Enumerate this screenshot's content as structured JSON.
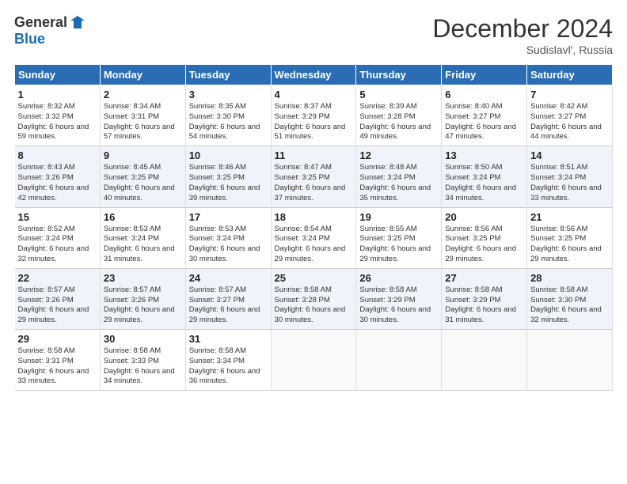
{
  "header": {
    "logo_line1": "General",
    "logo_line2": "Blue",
    "month": "December 2024",
    "location": "Sudislavl', Russia"
  },
  "weekdays": [
    "Sunday",
    "Monday",
    "Tuesday",
    "Wednesday",
    "Thursday",
    "Friday",
    "Saturday"
  ],
  "weeks": [
    [
      {
        "day": "1",
        "sunrise": "8:32 AM",
        "sunset": "3:32 PM",
        "daylight": "6 hours and 59 minutes."
      },
      {
        "day": "2",
        "sunrise": "8:34 AM",
        "sunset": "3:31 PM",
        "daylight": "6 hours and 57 minutes."
      },
      {
        "day": "3",
        "sunrise": "8:35 AM",
        "sunset": "3:30 PM",
        "daylight": "6 hours and 54 minutes."
      },
      {
        "day": "4",
        "sunrise": "8:37 AM",
        "sunset": "3:29 PM",
        "daylight": "6 hours and 51 minutes."
      },
      {
        "day": "5",
        "sunrise": "8:39 AM",
        "sunset": "3:28 PM",
        "daylight": "6 hours and 49 minutes."
      },
      {
        "day": "6",
        "sunrise": "8:40 AM",
        "sunset": "3:27 PM",
        "daylight": "6 hours and 47 minutes."
      },
      {
        "day": "7",
        "sunrise": "8:42 AM",
        "sunset": "3:27 PM",
        "daylight": "6 hours and 44 minutes."
      }
    ],
    [
      {
        "day": "8",
        "sunrise": "8:43 AM",
        "sunset": "3:26 PM",
        "daylight": "6 hours and 42 minutes."
      },
      {
        "day": "9",
        "sunrise": "8:45 AM",
        "sunset": "3:25 PM",
        "daylight": "6 hours and 40 minutes."
      },
      {
        "day": "10",
        "sunrise": "8:46 AM",
        "sunset": "3:25 PM",
        "daylight": "6 hours and 39 minutes."
      },
      {
        "day": "11",
        "sunrise": "8:47 AM",
        "sunset": "3:25 PM",
        "daylight": "6 hours and 37 minutes."
      },
      {
        "day": "12",
        "sunrise": "8:48 AM",
        "sunset": "3:24 PM",
        "daylight": "6 hours and 35 minutes."
      },
      {
        "day": "13",
        "sunrise": "8:50 AM",
        "sunset": "3:24 PM",
        "daylight": "6 hours and 34 minutes."
      },
      {
        "day": "14",
        "sunrise": "8:51 AM",
        "sunset": "3:24 PM",
        "daylight": "6 hours and 33 minutes."
      }
    ],
    [
      {
        "day": "15",
        "sunrise": "8:52 AM",
        "sunset": "3:24 PM",
        "daylight": "6 hours and 32 minutes."
      },
      {
        "day": "16",
        "sunrise": "8:53 AM",
        "sunset": "3:24 PM",
        "daylight": "6 hours and 31 minutes."
      },
      {
        "day": "17",
        "sunrise": "8:53 AM",
        "sunset": "3:24 PM",
        "daylight": "6 hours and 30 minutes."
      },
      {
        "day": "18",
        "sunrise": "8:54 AM",
        "sunset": "3:24 PM",
        "daylight": "6 hours and 29 minutes."
      },
      {
        "day": "19",
        "sunrise": "8:55 AM",
        "sunset": "3:25 PM",
        "daylight": "6 hours and 29 minutes."
      },
      {
        "day": "20",
        "sunrise": "8:56 AM",
        "sunset": "3:25 PM",
        "daylight": "6 hours and 29 minutes."
      },
      {
        "day": "21",
        "sunrise": "8:56 AM",
        "sunset": "3:25 PM",
        "daylight": "6 hours and 29 minutes."
      }
    ],
    [
      {
        "day": "22",
        "sunrise": "8:57 AM",
        "sunset": "3:26 PM",
        "daylight": "6 hours and 29 minutes."
      },
      {
        "day": "23",
        "sunrise": "8:57 AM",
        "sunset": "3:26 PM",
        "daylight": "6 hours and 29 minutes."
      },
      {
        "day": "24",
        "sunrise": "8:57 AM",
        "sunset": "3:27 PM",
        "daylight": "6 hours and 29 minutes."
      },
      {
        "day": "25",
        "sunrise": "8:58 AM",
        "sunset": "3:28 PM",
        "daylight": "6 hours and 30 minutes."
      },
      {
        "day": "26",
        "sunrise": "8:58 AM",
        "sunset": "3:29 PM",
        "daylight": "6 hours and 30 minutes."
      },
      {
        "day": "27",
        "sunrise": "8:58 AM",
        "sunset": "3:29 PM",
        "daylight": "6 hours and 31 minutes."
      },
      {
        "day": "28",
        "sunrise": "8:58 AM",
        "sunset": "3:30 PM",
        "daylight": "6 hours and 32 minutes."
      }
    ],
    [
      {
        "day": "29",
        "sunrise": "8:58 AM",
        "sunset": "3:31 PM",
        "daylight": "6 hours and 33 minutes."
      },
      {
        "day": "30",
        "sunrise": "8:58 AM",
        "sunset": "3:33 PM",
        "daylight": "6 hours and 34 minutes."
      },
      {
        "day": "31",
        "sunrise": "8:58 AM",
        "sunset": "3:34 PM",
        "daylight": "6 hours and 36 minutes."
      },
      null,
      null,
      null,
      null
    ]
  ]
}
